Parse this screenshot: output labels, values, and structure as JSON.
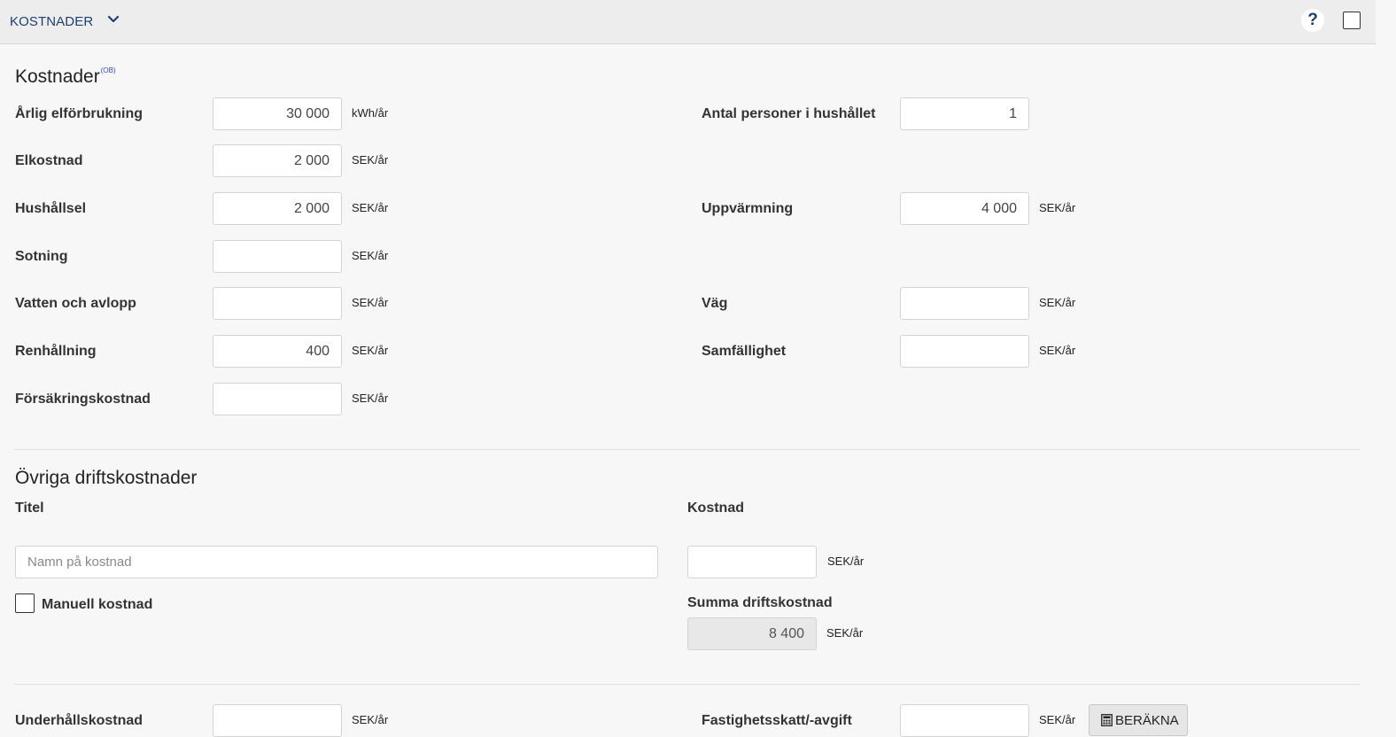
{
  "header": {
    "section_title": "KOSTNADER"
  },
  "kostnader": {
    "title": "Kostnader",
    "badge": "(OB)",
    "fields": {
      "arlig_elforbrukning": {
        "label": "Årlig elförbrukning",
        "value": "30 000",
        "unit": "kWh/år"
      },
      "elkostnad": {
        "label": "Elkostnad",
        "value": "2 000",
        "unit": "SEK/år"
      },
      "hushallsel": {
        "label": "Hushållsel",
        "value": "2 000",
        "unit": "SEK/år"
      },
      "sotning": {
        "label": "Sotning",
        "value": "",
        "unit": "SEK/år"
      },
      "vatten": {
        "label": "Vatten och avlopp",
        "value": "",
        "unit": "SEK/år"
      },
      "renhallning": {
        "label": "Renhållning",
        "value": "400",
        "unit": "SEK/år"
      },
      "forsakring": {
        "label": "Försäkringskostnad",
        "value": "",
        "unit": "SEK/år"
      },
      "antal_personer": {
        "label": "Antal personer i hushållet",
        "value": "1"
      },
      "uppvarmning": {
        "label": "Uppvärmning",
        "value": "4 000",
        "unit": "SEK/år"
      },
      "vag": {
        "label": "Väg",
        "value": "",
        "unit": "SEK/år"
      },
      "samfallighet": {
        "label": "Samfällighet",
        "value": "",
        "unit": "SEK/år"
      }
    }
  },
  "ovriga": {
    "title": "Övriga driftskostnader",
    "col_titel": "Titel",
    "col_kostnad": "Kostnad",
    "name_placeholder": "Namn på kostnad",
    "name_value": "",
    "cost_value": "",
    "cost_unit": "SEK/år",
    "manual_label": "Manuell kostnad",
    "manual_checked": false,
    "summa_label": "Summa driftskostnad",
    "summa_value": "8 400",
    "summa_unit": "SEK/år"
  },
  "bottom": {
    "underhall": {
      "label": "Underhållskostnad",
      "value": "",
      "unit": "SEK/år"
    },
    "fastighetsskatt": {
      "label": "Fastighetsskatt/-avgift",
      "value": "",
      "unit": "SEK/år"
    },
    "calc_button": "BERÄKNA"
  }
}
